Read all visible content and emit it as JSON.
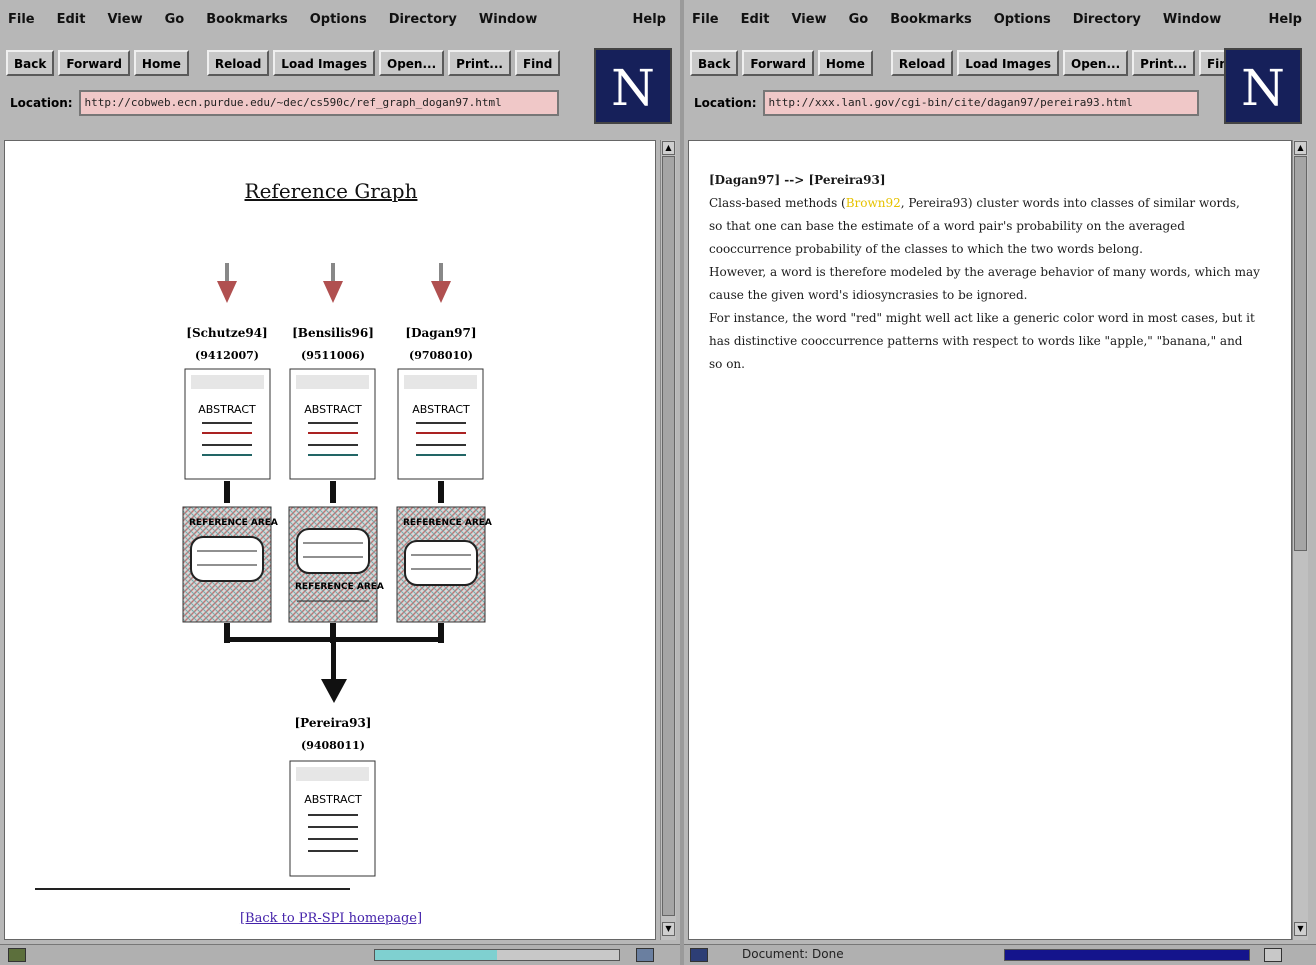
{
  "left_window": {
    "menu": [
      "File",
      "Edit",
      "View",
      "Go",
      "Bookmarks",
      "Options",
      "Directory",
      "Window"
    ],
    "help": "Help",
    "toolbar": [
      "Back",
      "Forward",
      "Home",
      "Reload",
      "Load Images",
      "Open...",
      "Print...",
      "Find"
    ],
    "location_label": "Location:",
    "location_value": "http://cobweb.ecn.purdue.edu/~dec/cs590c/ref_graph_dogan97.html",
    "logo": "N",
    "page": {
      "title": "Reference Graph",
      "papers": [
        {
          "cite": "[Schutze94]",
          "id": "(9412007)",
          "abstract": "ABSTRACT",
          "refs_label": "REFERENCE AREA"
        },
        {
          "cite": "[Bensilis96]",
          "id": "(9511006)",
          "abstract": "ABSTRACT",
          "refs_label": "REFERENCE AREA"
        },
        {
          "cite": "[Dagan97]",
          "id": "(9708010)",
          "abstract": "ABSTRACT",
          "refs_label": "REFERENCE AREA"
        }
      ],
      "target": {
        "cite": "[Pereira93]",
        "id": "(9408011)",
        "abstract": "ABSTRACT"
      },
      "back_link": "[Back to PR-SPI homepage]"
    },
    "status": {
      "text": "",
      "progress": 0.5
    }
  },
  "right_window": {
    "menu": [
      "File",
      "Edit",
      "View",
      "Go",
      "Bookmarks",
      "Options",
      "Directory",
      "Window"
    ],
    "help": "Help",
    "toolbar": [
      "Back",
      "Forward",
      "Home",
      "Reload",
      "Load Images",
      "Open...",
      "Print...",
      "Find"
    ],
    "location_label": "Location:",
    "location_value": "http://xxx.lanl.gov/cgi-bin/cite/dagan97/pereira93.html",
    "logo": "N",
    "page": {
      "heading": "[Dagan97] --> [Pereira93]",
      "lines": [
        {
          "pre": "Class-based methods (",
          "hl": "Brown92",
          "post": ", Pereira93) cluster words into classes of similar words,"
        },
        {
          "pre": "so that one can base the estimate of a word pair's probability on the averaged",
          "hl": "",
          "post": ""
        },
        {
          "pre": "cooccurrence probability of the classes to which the two words belong.",
          "hl": "",
          "post": ""
        },
        {
          "pre": "However, a word is therefore modeled by the average behavior of many words, which may",
          "hl": "",
          "post": ""
        },
        {
          "pre": "cause the given word's idiosyncrasies to be ignored.",
          "hl": "",
          "post": ""
        },
        {
          "pre": "For instance, the word \"red\" might well act like a generic color word in most cases, but it",
          "hl": "",
          "post": ""
        },
        {
          "pre": "has distinctive cooccurrence patterns with respect to words like \"apple,\" \"banana,\" and",
          "hl": "",
          "post": ""
        },
        {
          "pre": "so on.",
          "hl": "",
          "post": ""
        }
      ]
    },
    "status": {
      "text": "Document: Done",
      "progress": 1.0
    }
  },
  "colors": {
    "location_bg": "#f0c8c8",
    "logo_bg": "#16205a",
    "link": "#4422aa",
    "highlight": "#e6c200",
    "progress_left": "#7fd0d0",
    "progress_right": "#14148c"
  }
}
